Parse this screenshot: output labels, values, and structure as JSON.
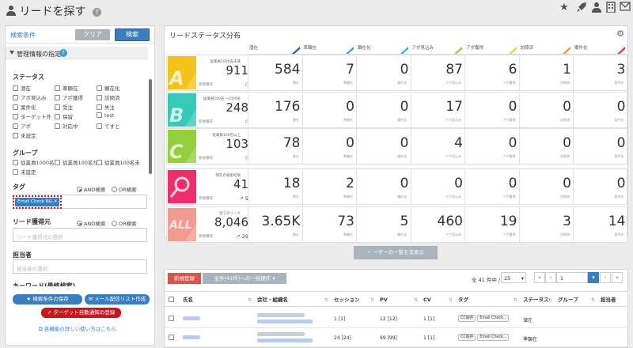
{
  "header": {
    "title": "リードを探す"
  },
  "left": {
    "tab_label": "検索条件",
    "clear_label": "クリア",
    "search_label": "検索",
    "section_label": "管理情報の指定",
    "status_title": "ステータス",
    "status_items": [
      "潜在",
      "準顕在",
      "顕在化",
      "アポ見込み",
      "アポ獲得",
      "訪問済",
      "案件化",
      "受注",
      "失注",
      "ターゲット外",
      "保留",
      "test",
      "アポ",
      "対応中",
      "てすと",
      "未設定"
    ],
    "group_title": "グループ",
    "group_items": [
      "従業員1000名",
      "従業員100名から",
      "従業員100名未",
      "未設定"
    ],
    "tag_title": "タグ",
    "and_label": "AND検索",
    "or_label": "OR検索",
    "tag_value": "Email Check NG",
    "source_title": "リード獲得元",
    "source_placeholder": "リード獲得元の選択",
    "owner_title": "担当者",
    "owner_placeholder": "担当者の選択",
    "keyword_title": "キーワード(最終検索)",
    "save_btn": "検索条件の保存",
    "mail_btn": "メール配信リスト作成",
    "notify_btn": "ターゲット自動通知の登録",
    "help_link": "各機能の詳しい使い方はこちら"
  },
  "status_panel": {
    "title": "リードステータス分布",
    "columns": [
      "潜在",
      "準顕在",
      "顕在化",
      "アポ見込み",
      "アポ獲得",
      "訪問済",
      "案件化"
    ],
    "column_colors": [
      "#2451a6",
      "#3a8fe0",
      "#1bb0e6",
      "#8ccc2c",
      "#f2d400",
      "#f48a1a",
      "#e0262e"
    ],
    "rows": [
      {
        "label": "従業員1000名未満",
        "total": "911",
        "sub_label": "新規獲得",
        "sub": "0",
        "values": [
          "584",
          "7",
          "0",
          "87",
          "6",
          "1",
          "3"
        ],
        "color": "#f3c417",
        "letter": "A"
      },
      {
        "label": "従業員100名〜1000名",
        "total": "248",
        "sub_label": "新規獲得",
        "sub": "0",
        "values": [
          "176",
          "0",
          "0",
          "17",
          "0",
          "0",
          "0"
        ],
        "color": "#36c9b9",
        "letter": "B"
      },
      {
        "label": "従業員100名以上",
        "total": "103",
        "sub_label": "新規獲得",
        "sub": "0",
        "values": [
          "78",
          "0",
          "0",
          "4",
          "0",
          "0",
          "0"
        ],
        "color": "#94cf3c",
        "letter": "C"
      },
      {
        "label": "現在の検索結果",
        "total": "41",
        "sub_label": "新規獲得",
        "sub": "5",
        "values": [
          "18",
          "2",
          "0",
          "0",
          "0",
          "0",
          "0"
        ],
        "color": "#ef2d6a",
        "letter": ""
      },
      {
        "label": "全てのリード",
        "total": "8,046",
        "sub_label": "新規獲得",
        "sub": "29",
        "values": [
          "3.65K",
          "73",
          "5",
          "460",
          "19",
          "3",
          "14"
        ],
        "color": "#f59a8f",
        "letter": "ALL"
      }
    ],
    "value_sublabels": [
      "潜在",
      "準顕在",
      "顕在化",
      "アポ見込み",
      "アポ獲得",
      "訪問済",
      "案件化"
    ]
  },
  "list": {
    "more_btn": "ーザーの一覧を非表示",
    "new_btn": "新規登録",
    "bulk_btn": "全件(41件)への一括操作",
    "count_text": "全 41 件中 /",
    "per_page": "25",
    "page_value": "1",
    "headers": [
      "氏名",
      "会社・組織名",
      "セッション",
      "PV",
      "CV",
      "タグ",
      "ステータス",
      "グループ",
      "担当者"
    ],
    "rows": [
      {
        "session": "1 [1]",
        "pv": "12 [12]",
        "cv": "1 [1]",
        "tags": [
          "CC既存",
          "Email Check..."
        ],
        "status": "潜在"
      },
      {
        "session": "24 [24]",
        "pv": "99 [99]",
        "cv": "1 [1]",
        "tags": [
          "CC既存",
          "Email Check..."
        ],
        "status": "準顕在"
      }
    ]
  }
}
